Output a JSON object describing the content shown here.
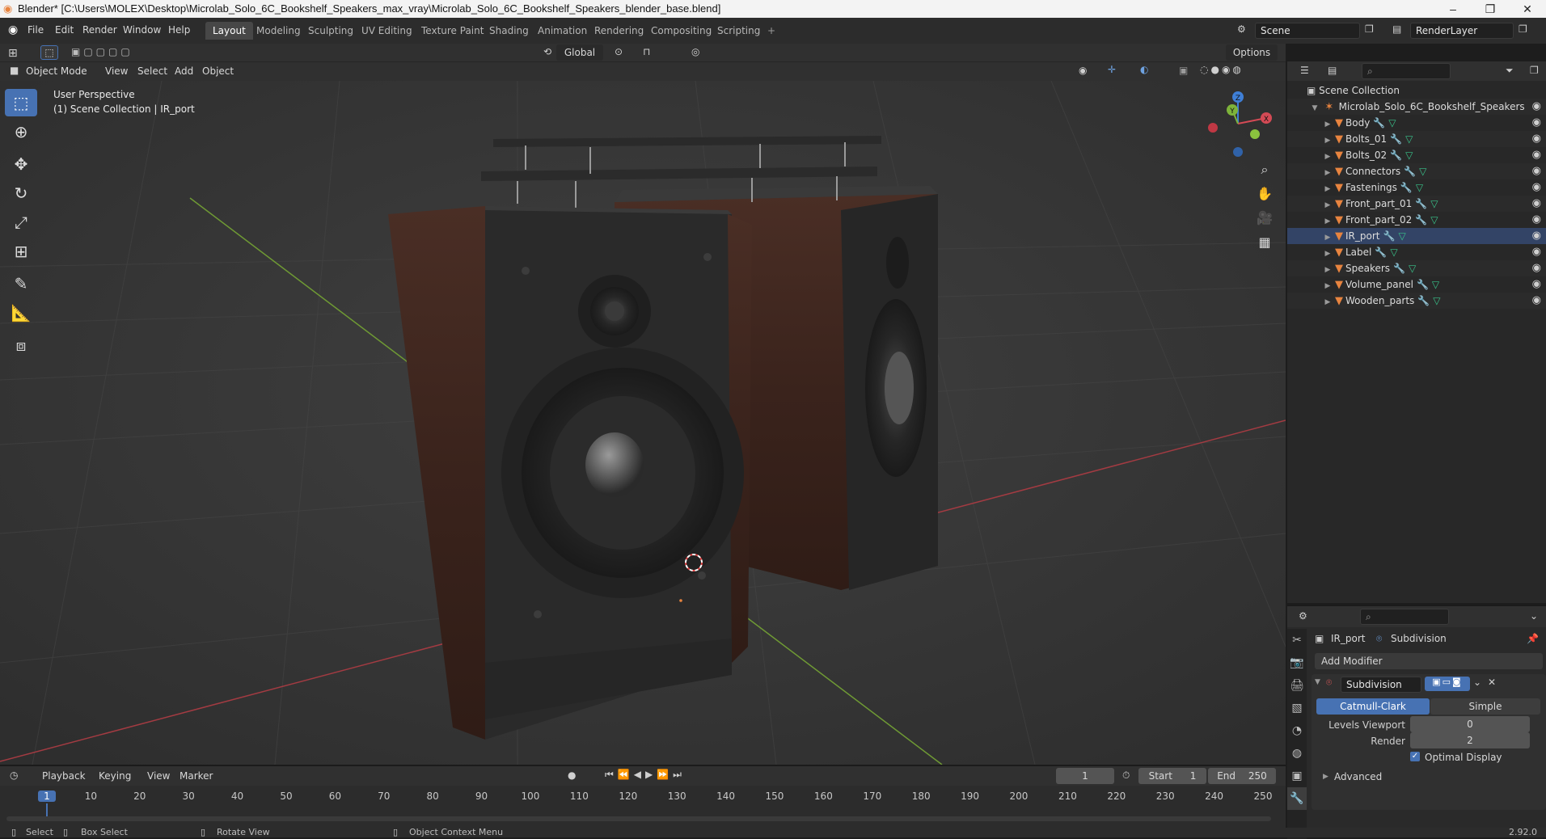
{
  "window": {
    "title": "Blender* [C:\\Users\\MOLEX\\Desktop\\Microlab_Solo_6C_Bookshelf_Speakers_max_vray\\Microlab_Solo_6C_Bookshelf_Speakers_blender_base.blend]",
    "minimize": "–",
    "maximize": "❐",
    "close": "✕"
  },
  "menu": [
    "File",
    "Edit",
    "Render",
    "Window",
    "Help"
  ],
  "workspaces": [
    "Layout",
    "Modeling",
    "Sculpting",
    "UV Editing",
    "Texture Paint",
    "Shading",
    "Animation",
    "Rendering",
    "Compositing",
    "Scripting"
  ],
  "workspace_add": "+",
  "scene": {
    "name": "Scene",
    "render_layer": "RenderLayer"
  },
  "tool_header": {
    "transform_orientation": "Global",
    "options": "Options"
  },
  "viewport_header": {
    "mode": "Object Mode",
    "menus": [
      "View",
      "Select",
      "Add",
      "Object"
    ]
  },
  "viewport": {
    "perspective": "User Perspective",
    "collection_info": "(1) Scene Collection | IR_port"
  },
  "gizmo": {
    "x": "X",
    "y": "Y",
    "z": "Z"
  },
  "outliner": {
    "root": "Scene Collection",
    "parent": "Microlab_Solo_6C_Bookshelf_Speakers",
    "objects": [
      "Body",
      "Bolts_01",
      "Bolts_02",
      "Connectors",
      "Fastenings",
      "Front_part_01",
      "Front_part_02",
      "IR_port",
      "Label",
      "Speakers",
      "Volume_panel",
      "Wooden_parts"
    ]
  },
  "properties": {
    "object": "IR_port",
    "modifier_type": "Subdivision",
    "add_modifier": "Add Modifier",
    "modifier_name": "Subdivision",
    "algorithm_catmull": "Catmull-Clark",
    "algorithm_simple": "Simple",
    "levels_viewport_label": "Levels Viewport",
    "levels_viewport": "0",
    "render_label": "Render",
    "render": "2",
    "optimal_display": "Optimal Display",
    "advanced": "Advanced"
  },
  "timeline": {
    "menus": [
      "Playback",
      "Keying",
      "View",
      "Marker"
    ],
    "current_frame": "1",
    "start_label": "Start",
    "start": "1",
    "end_label": "End",
    "end": "250",
    "ticks": [
      "1",
      "10",
      "20",
      "30",
      "40",
      "50",
      "60",
      "70",
      "80",
      "90",
      "100",
      "110",
      "120",
      "130",
      "140",
      "150",
      "160",
      "170",
      "180",
      "190",
      "200",
      "210",
      "220",
      "230",
      "240",
      "250"
    ]
  },
  "statusbar": {
    "select": "Select",
    "box_select": "Box Select",
    "rotate": "Rotate View",
    "context": "Object Context Menu",
    "version": "2.92.0"
  },
  "colors": {
    "accent": "#4772b3",
    "object_icon": "#e8843f",
    "modifier_icon": "#6ea2e0",
    "mesh_icon": "#39c28a",
    "axis_x": "#b3323e",
    "axis_y": "#7aa03a"
  }
}
